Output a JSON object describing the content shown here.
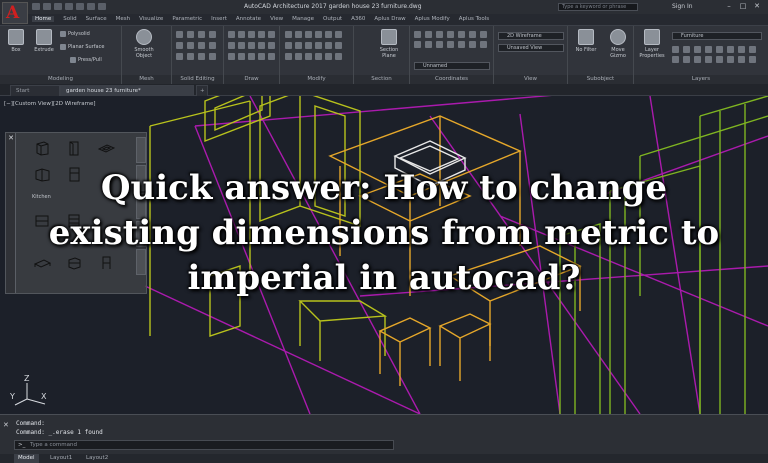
{
  "titlebar": {
    "app_letter": "A",
    "title": "AutoCAD Architecture 2017   garden house 23 furniture.dwg",
    "search_placeholder": "Type a keyword or phrase",
    "signin": "Sign In",
    "minimize": "–",
    "maximize": "□",
    "close": "✕"
  },
  "ribbon_tabs": [
    "Home",
    "Solid",
    "Surface",
    "Mesh",
    "Visualize",
    "Parametric",
    "Insert",
    "Annotate",
    "View",
    "Manage",
    "Output",
    "A360",
    "Aplus Draw",
    "Aplus Modify",
    "Aplus Tools"
  ],
  "ribbon": {
    "modeling": {
      "title": "Modeling",
      "box": "Box",
      "extrude": "Extrude",
      "polysolid": "Polysolid",
      "planar_surface": "Planar Surface",
      "presspull": "Press/Pull"
    },
    "mesh": {
      "title": "Mesh",
      "smooth_object": "Smooth Object"
    },
    "solid_editing": {
      "title": "Solid Editing"
    },
    "draw": {
      "title": "Draw"
    },
    "modify": {
      "title": "Modify"
    },
    "section": {
      "title": "Section",
      "section_plane": "Section Plane"
    },
    "coordinates": {
      "title": "Coordinates",
      "ucs_combo": "Unnamed"
    },
    "view": {
      "title": "View",
      "visual_style": "2D Wireframe",
      "saved_view": "Unsaved View"
    },
    "selection": {
      "title": "Subobject",
      "no_filter": "No Filter",
      "move_gizmo": "Move Gizmo"
    },
    "layers": {
      "title": "Layers",
      "layer_properties": "Layer Properties",
      "layer_name": "Furniture"
    }
  },
  "file_tabs": [
    "Start",
    "garden house 23 furniture*"
  ],
  "viewport": {
    "label": "[−][Custom View][2D Wireframe]"
  },
  "palette": {
    "close": "✕",
    "section_label": "Kitchen"
  },
  "headline": {
    "line1": "Quick answer: How to change",
    "line2": "existing dimensions from metric to",
    "line3": "imperial in autocad?"
  },
  "ucs": {
    "y": "Y",
    "z": "Z",
    "x": "X"
  },
  "command": {
    "history_1": "Command:",
    "history_2": "Command: _.erase 1 found",
    "prompt_marker": ">_",
    "placeholder": "Type a command",
    "close": "✕"
  },
  "layout_tabs": [
    "Model",
    "Layout1",
    "Layout2"
  ],
  "colors": {
    "wire_yellow": "#b8c21c",
    "wire_green": "#7fb521",
    "wire_orange": "#e5a72a",
    "wire_magenta": "#c31ac4",
    "wire_white": "#e8e8e8",
    "app_red": "#d02020"
  }
}
